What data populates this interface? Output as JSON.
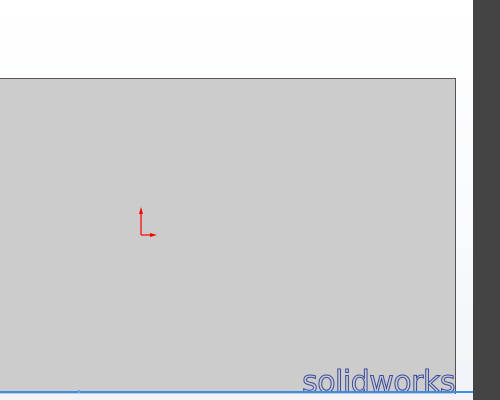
{
  "drawing": {
    "watermark_text": "solidworks"
  },
  "colors": {
    "sheet": "#cccccc",
    "right_panel": "#444444",
    "origin_arrows": "#ff0000",
    "watermark": "#3a4aa0",
    "bottom_line": "#3d8de8"
  },
  "icons": {
    "origin": "origin-axis-icon"
  }
}
